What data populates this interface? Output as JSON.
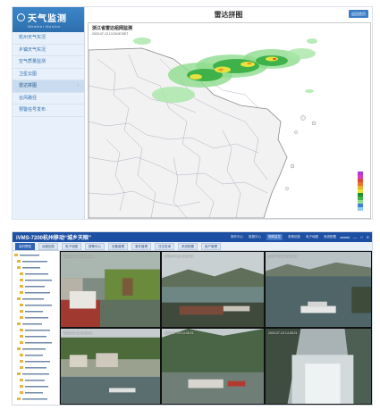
{
  "radar_app": {
    "logo": {
      "title": "天气监测",
      "subtitle": "Weather Monitor"
    },
    "sidebar": {
      "items": [
        {
          "label": "杭州天气实况"
        },
        {
          "label": "乡镇天气实况"
        },
        {
          "label": "空气质量监测"
        },
        {
          "label": "卫星云图"
        },
        {
          "label": "雷达拼图",
          "active": true
        },
        {
          "label": "台风路径"
        },
        {
          "label": "预警信号发布"
        }
      ]
    },
    "header": {
      "title": "雷达拼图",
      "button_label": "返回首页"
    },
    "map": {
      "title": "浙江省雷达组网监测",
      "time": "2020-07-13 13:30:00 BST"
    },
    "colors": {
      "sidebar_bg": "#e8f1fb",
      "logo_bg": "#2d6fae",
      "accent": "#3a7dc4"
    }
  },
  "ivms_app": {
    "title": "iVMS-7200杭州移动“城乡天眼”",
    "top_nav": [
      {
        "label": "操作中心"
      },
      {
        "label": "数据中心"
      },
      {
        "label": "视频监控",
        "active": true
      },
      {
        "label": "录像回放"
      },
      {
        "label": "电子地图"
      },
      {
        "label": "系统配置"
      }
    ],
    "window_controls": {
      "user": "admin",
      "minimize": "—",
      "maximize": "□",
      "close": "✕"
    },
    "toolbar_tabs": [
      {
        "label": "实时预览",
        "active": true
      },
      {
        "label": "远程回放"
      },
      {
        "label": "电子地图"
      },
      {
        "label": "报警中心"
      },
      {
        "label": "设备管理"
      },
      {
        "label": "事件管理"
      },
      {
        "label": "日志查询"
      },
      {
        "label": "系统配置"
      },
      {
        "label": "用户管理"
      }
    ],
    "cameras": [
      {
        "label": "2020-07-13 14:35:21"
      },
      {
        "label": "2020-07-13 14:35:21"
      },
      {
        "label": "2020-07-13 14:35:21"
      },
      {
        "label": "2020-07-13 14:35:21"
      },
      {
        "label": "2020-07-13 14:35:21"
      },
      {
        "label": "2020-07-13 14:35:21"
      }
    ],
    "colors": {
      "titlebar": "#1d4fa3",
      "tab_active": "#2f63b5",
      "folder": "#e2b640"
    }
  }
}
